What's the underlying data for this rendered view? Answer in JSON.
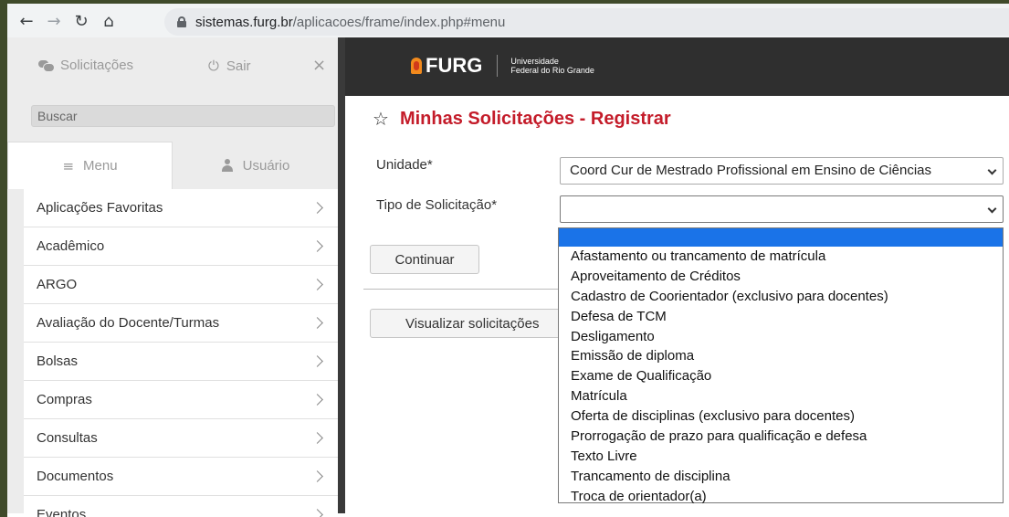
{
  "browser": {
    "url_host": "sistemas.furg.br",
    "url_path": "/aplicacoes/frame/index.php#menu"
  },
  "sidebar": {
    "solicitacoes_label": "Solicitações",
    "sair_label": "Sair",
    "search_placeholder": "Buscar",
    "tabs": [
      {
        "label": "Menu"
      },
      {
        "label": "Usuário"
      }
    ],
    "items": [
      {
        "label": "Aplicações Favoritas"
      },
      {
        "label": "Acadêmico"
      },
      {
        "label": "ARGO"
      },
      {
        "label": "Avaliação do Docente/Turmas"
      },
      {
        "label": "Bolsas"
      },
      {
        "label": "Compras"
      },
      {
        "label": "Consultas"
      },
      {
        "label": "Documentos"
      },
      {
        "label": "Eventos"
      }
    ]
  },
  "header": {
    "logo": "FURG",
    "sub_line1": "Universidade",
    "sub_line2": "Federal do Rio Grande"
  },
  "main": {
    "title": "Minhas Solicitações - Registrar",
    "unidade_label": "Unidade",
    "unidade_value": "Coord Cur de Mestrado Profissional em Ensino de Ciências",
    "tipo_label": "Tipo de Solicitação",
    "tipo_value": "",
    "required_mark": "*",
    "continuar_label": "Continuar",
    "visualizar_label": "Visualizar solicitações",
    "options": [
      "Afastamento ou trancamento de matrícula",
      "Aproveitamento de Créditos",
      "Cadastro de Coorientador (exclusivo para docentes)",
      "Defesa de TCM",
      "Desligamento",
      "Emissão de diploma",
      "Exame de Qualificação",
      "Matrícula",
      "Oferta de disciplinas (exclusivo para docentes)",
      "Prorrogação de prazo para qualificação e defesa",
      "Texto Livre",
      "Trancamento de disciplina",
      "Troca de orientador(a)"
    ]
  }
}
